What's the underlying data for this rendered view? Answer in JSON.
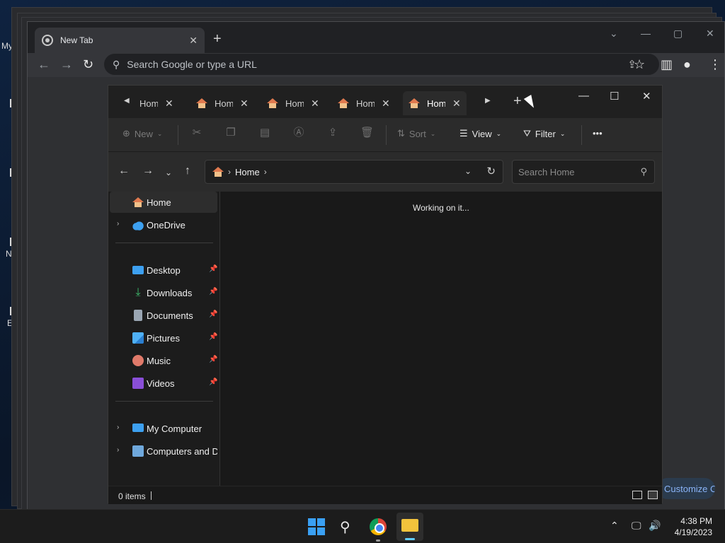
{
  "desktop": {
    "labels": [
      "My",
      "N",
      "E"
    ]
  },
  "chrome": {
    "tab_title": "New Tab",
    "tab_close": "✕",
    "new_tab": "+",
    "omnibox_placeholder": "Search Google or type a URL",
    "customize_label": "Customize Chrome"
  },
  "explorer": {
    "tabs": [
      {
        "label": "Home",
        "active": false
      },
      {
        "label": "Home",
        "active": false
      },
      {
        "label": "Home",
        "active": false
      },
      {
        "label": "Home",
        "active": false
      },
      {
        "label": "Home",
        "active": true
      }
    ],
    "commands": {
      "new": "New",
      "sort": "Sort",
      "view": "View",
      "filter": "Filter",
      "more": "•••"
    },
    "address": {
      "crumb": "Home"
    },
    "search_placeholder": "Search Home",
    "nav_pane": {
      "home": "Home",
      "onedrive": "OneDrive",
      "desktop": "Desktop",
      "downloads": "Downloads",
      "documents": "Documents",
      "pictures": "Pictures",
      "music": "Music",
      "videos": "Videos",
      "my_computer": "My Computer",
      "computers_and_devices": "Computers and Devices"
    },
    "loading_text": "Working on it...",
    "status": {
      "item_count": "0 items"
    }
  },
  "taskbar": {
    "time": "4:38 PM",
    "date": "4/19/2023"
  }
}
